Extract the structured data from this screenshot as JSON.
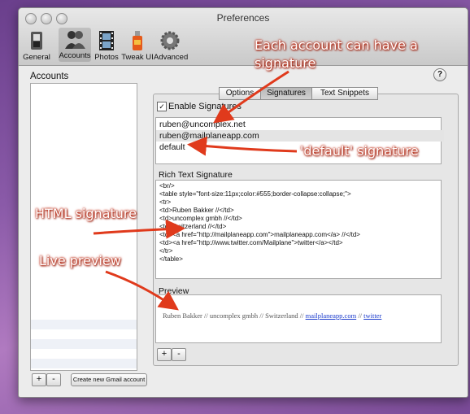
{
  "window": {
    "title": "Preferences"
  },
  "toolbar": {
    "items": [
      {
        "label": "General",
        "icon": "switch-icon"
      },
      {
        "label": "Accounts",
        "icon": "people-icon"
      },
      {
        "label": "Photos",
        "icon": "film-icon"
      },
      {
        "label": "Tweak UI",
        "icon": "bottle-icon"
      },
      {
        "label": "Advanced",
        "icon": "gear-icon"
      }
    ]
  },
  "accounts": {
    "title": "Accounts",
    "add_label": "+",
    "remove_label": "-",
    "create_label": "Create new Gmail account"
  },
  "help": {
    "label": "?"
  },
  "tabs": [
    "Options",
    "Signatures",
    "Text Snippets"
  ],
  "enable_signatures": {
    "label": "Enable Signatures",
    "checked": true,
    "mark": "✓"
  },
  "signatures": [
    "ruben@uncomplex.net",
    "ruben@mailplaneapp.com",
    "default"
  ],
  "rich_text": {
    "label": "Rich Text Signature",
    "lines": [
      "<br/>",
      "<table style=\"font-size:11px;color:#555;border-collapse:collapse;\">",
      "<tr>",
      "<td>Ruben Bakker //</td>",
      "<td>uncomplex gmbh //</td>",
      "<td>Switzerland //</td>",
      "<td><a href=\"http://mailplaneapp.com\">mailplaneapp.com</a> //</td>",
      "<td><a href=\"http://www.twitter.com/Mailplane\">twitter</a></td>",
      "</tr>",
      "</table>"
    ]
  },
  "preview": {
    "label": "Preview",
    "text_before": "Ruben Bakker // uncomplex gmbh // Switzerland // ",
    "link1": "mailplaneapp.com",
    "separator": " // ",
    "link2": "twitter"
  },
  "sig_buttons": {
    "add": "+",
    "remove": "-"
  },
  "annotations": {
    "account": "Each account can have a signature",
    "account_line1": "Each account can have a",
    "account_line2": "signature",
    "default": "'default' signature",
    "html": "HTML signature",
    "live": "Live preview"
  },
  "colors": {
    "annotation": "#e03a1c",
    "link": "#1a3acc"
  }
}
